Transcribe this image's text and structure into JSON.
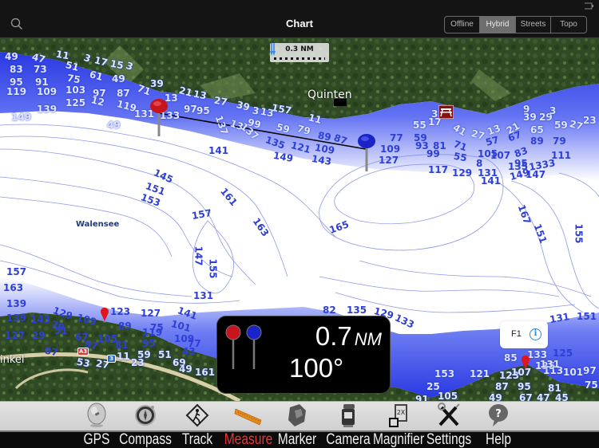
{
  "header": {
    "title": "Chart",
    "map_types": [
      {
        "label": "Offline",
        "active": false
      },
      {
        "label": "Hybrid",
        "active": true
      },
      {
        "label": "Streets",
        "active": false
      },
      {
        "label": "Topo",
        "active": false
      }
    ]
  },
  "map": {
    "scale_label": "0.3 NM",
    "places": [
      {
        "name": "Quinten",
        "kind": "town"
      },
      {
        "name": "Walensee",
        "kind": "lake"
      },
      {
        "name": "inkel",
        "kind": "town"
      }
    ],
    "road_shields": [
      {
        "label": "A3",
        "color": "#d9363a"
      },
      {
        "label": "3",
        "color": "#2a6fd0"
      }
    ],
    "marker_callout": {
      "label": "F1",
      "info_icon": "info-icon"
    },
    "depth_labels": [
      "49",
      "47",
      "11",
      "3",
      "17",
      "15",
      "3",
      "83",
      "73",
      "51",
      "75",
      "61",
      "49",
      "95",
      "91",
      "39",
      "21",
      "13",
      "119",
      "109",
      "103",
      "97",
      "87",
      "71",
      "13",
      "125",
      "12",
      "119",
      "139",
      "131",
      "133",
      "97",
      "149",
      "49",
      "27",
      "39",
      "3",
      "13",
      "157",
      "11",
      "95",
      "99",
      "137",
      "13",
      "137",
      "59",
      "79",
      "89",
      "87",
      "141",
      "135",
      "121",
      "109",
      "143",
      "149",
      "109",
      "127",
      "55",
      "77",
      "3",
      "17",
      "59",
      "41",
      "27",
      "13",
      "21",
      "9",
      "39",
      "29",
      "3",
      "65",
      "59",
      "27",
      "23",
      "93",
      "81",
      "71",
      "57",
      "67",
      "89",
      "79",
      "99",
      "55",
      "105",
      "107",
      "83",
      "8",
      "95",
      "111",
      "117",
      "129",
      "131",
      "135",
      "1333",
      "141",
      "149",
      "147",
      "145",
      "151",
      "153",
      "157",
      "161",
      "163",
      "147",
      "155",
      "165",
      "167",
      "151",
      "155",
      "157",
      "163",
      "139",
      "129",
      "109",
      "123",
      "127",
      "141",
      "139",
      "143",
      "79",
      "89",
      "101",
      "131",
      "127",
      "29",
      "51",
      "67",
      "105",
      "119",
      "97",
      "81",
      "95",
      "75",
      "109",
      "77",
      "87",
      "11",
      "59",
      "51",
      "53",
      "27",
      "23",
      "69",
      "49",
      "43",
      "161",
      "82",
      "135",
      "129",
      "133",
      "131",
      "151",
      "153",
      "121",
      "123",
      "25",
      "107",
      "113",
      "101",
      "97",
      "91",
      "105",
      "87",
      "95",
      "81",
      "75",
      "49",
      "67",
      "47",
      "45",
      "25",
      "73",
      "85",
      "133",
      "135",
      "125",
      "131",
      "115"
    ]
  },
  "measure": {
    "distance": "0.7",
    "distance_unit": "NM",
    "bearing": "100°",
    "start_pin_color": "#c8141c",
    "end_pin_color": "#1a22c8"
  },
  "toolbar": {
    "items": [
      {
        "label": "GPS",
        "icon": "gps-icon",
        "active": false
      },
      {
        "label": "Compass",
        "icon": "compass-icon",
        "active": false
      },
      {
        "label": "Track",
        "icon": "track-icon",
        "active": false
      },
      {
        "label": "Measure",
        "icon": "ruler-icon",
        "active": true
      },
      {
        "label": "Marker",
        "icon": "marker-icon",
        "active": false
      },
      {
        "label": "Camera",
        "icon": "camera-icon",
        "active": false
      },
      {
        "label": "Magnifier",
        "icon": "magnifier-icon",
        "active": false
      },
      {
        "label": "Settings",
        "icon": "settings-icon",
        "active": false
      },
      {
        "label": "Help",
        "icon": "help-icon",
        "active": false
      }
    ],
    "active_color": "#e8353a"
  }
}
